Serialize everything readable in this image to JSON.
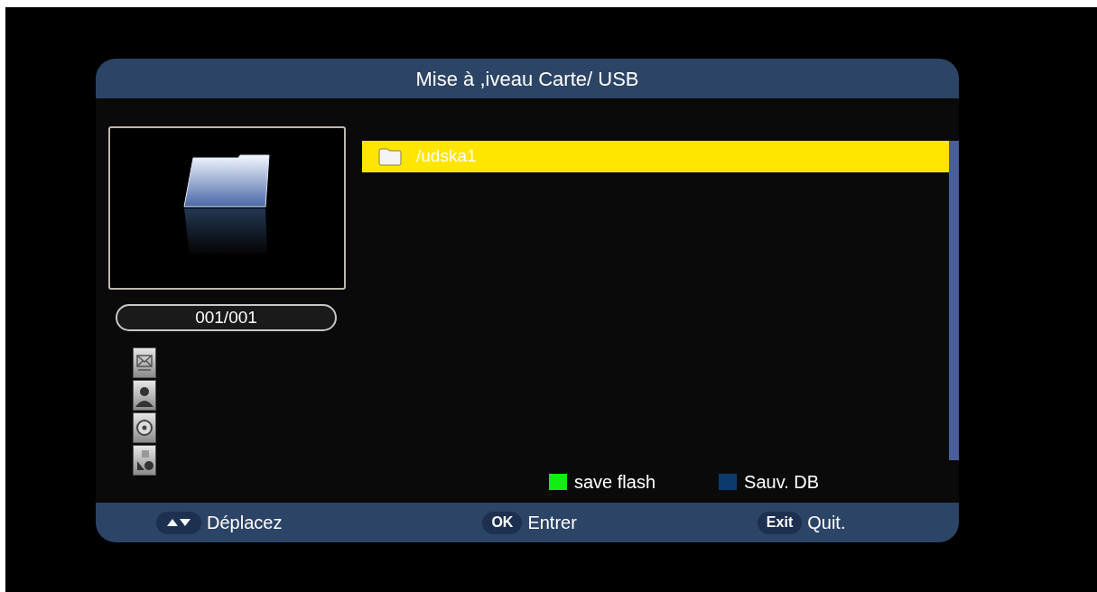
{
  "window": {
    "title": "Mise à ,iveau Carte/ USB"
  },
  "preview": {
    "counter": "001/001"
  },
  "files": [
    {
      "name": "/udska1",
      "selected": true
    }
  ],
  "color_keys": [
    {
      "label": "save flash",
      "color": "#11ee11"
    },
    {
      "label": "Sauv. DB",
      "color": "#0d3a6e"
    }
  ],
  "footer": [
    {
      "kind": "arrows",
      "label": "Déplacez"
    },
    {
      "kind": "key",
      "key": "OK",
      "label": "Entrer"
    },
    {
      "kind": "key",
      "key": "Exit",
      "label": "Quit."
    }
  ]
}
